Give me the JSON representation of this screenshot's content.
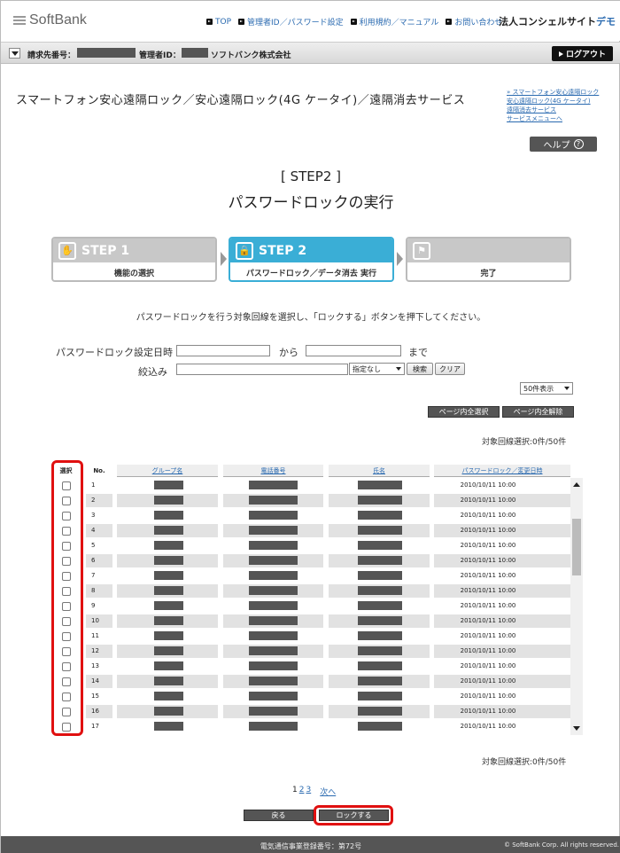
{
  "header": {
    "logo": "SoftBank",
    "nav": [
      "TOP",
      "管理者ID／パスワード設定",
      "利用規約／マニュアル",
      "お問い合わせ"
    ],
    "site_name": "法人コンシェルサイト",
    "site_tag": "デモ"
  },
  "account": {
    "billing_label": "請求先番号：",
    "admin_label": "管理者ID：",
    "company": "ソフトバンク株式会社",
    "logout": "ログアウト"
  },
  "service_title": "スマートフォン安心遠隔ロック／安心遠隔ロック(4G ケータイ)／遠隔消去サービス",
  "side_links": [
    "» スマートフォン安心遠隔ロック",
    "安心遠隔ロック(4G ケータイ)",
    "遠隔消去サービス",
    "サービスメニューへ"
  ],
  "help": "ヘルプ",
  "step_no": "[ STEP2 ]",
  "step_title": "パスワードロックの実行",
  "steps": [
    {
      "num": "STEP 1",
      "label": "機能の選択",
      "icon": "✋"
    },
    {
      "num": "STEP 2",
      "label": "パスワードロック／データ消去 実行",
      "icon": "🔒"
    },
    {
      "num": "",
      "label": "完了",
      "icon": "⚑"
    }
  ],
  "instruction": "パスワードロックを行う対象回線を選択し、「ロックする」ボタンを押下してください。",
  "filter": {
    "date_label": "パスワードロック設定日時",
    "from": "から",
    "to": "まで",
    "narrow_label": "絞込み",
    "narrow_select": "指定なし",
    "search": "検索",
    "clear": "クリア",
    "per_page": "50件表示"
  },
  "select_all_page": "ページ内全選択",
  "deselect_all_page": "ページ内全解除",
  "selected_count": "対象回線選択:0件/50件",
  "table": {
    "headers": [
      "選択",
      "No.",
      "グループ名",
      "電話番号",
      "氏名",
      "パスワードロック／変更日時"
    ],
    "rows": [
      {
        "no": "1",
        "date": "2010/10/11 10:00"
      },
      {
        "no": "2",
        "date": "2010/10/11 10:00"
      },
      {
        "no": "3",
        "date": "2010/10/11 10:00"
      },
      {
        "no": "4",
        "date": "2010/10/11 10:00"
      },
      {
        "no": "5",
        "date": "2010/10/11 10:00"
      },
      {
        "no": "6",
        "date": "2010/10/11 10:00"
      },
      {
        "no": "7",
        "date": "2010/10/11 10:00"
      },
      {
        "no": "8",
        "date": "2010/10/11 10:00"
      },
      {
        "no": "9",
        "date": "2010/10/11 10:00"
      },
      {
        "no": "10",
        "date": "2010/10/11 10:00"
      },
      {
        "no": "11",
        "date": "2010/10/11 10:00"
      },
      {
        "no": "12",
        "date": "2010/10/11 10:00"
      },
      {
        "no": "13",
        "date": "2010/10/11 10:00"
      },
      {
        "no": "14",
        "date": "2010/10/11 10:00"
      },
      {
        "no": "15",
        "date": "2010/10/11 10:00"
      },
      {
        "no": "16",
        "date": "2010/10/11 10:00"
      },
      {
        "no": "17",
        "date": "2010/10/11 10:00"
      }
    ]
  },
  "pager": {
    "pages": [
      "1",
      "2",
      "3"
    ],
    "next": "次へ"
  },
  "back": "戻る",
  "lock": "ロックする",
  "footer": {
    "reg": "電気通信事業登録番号：第72号",
    "copy": "© SoftBank Corp. All rights reserved."
  }
}
